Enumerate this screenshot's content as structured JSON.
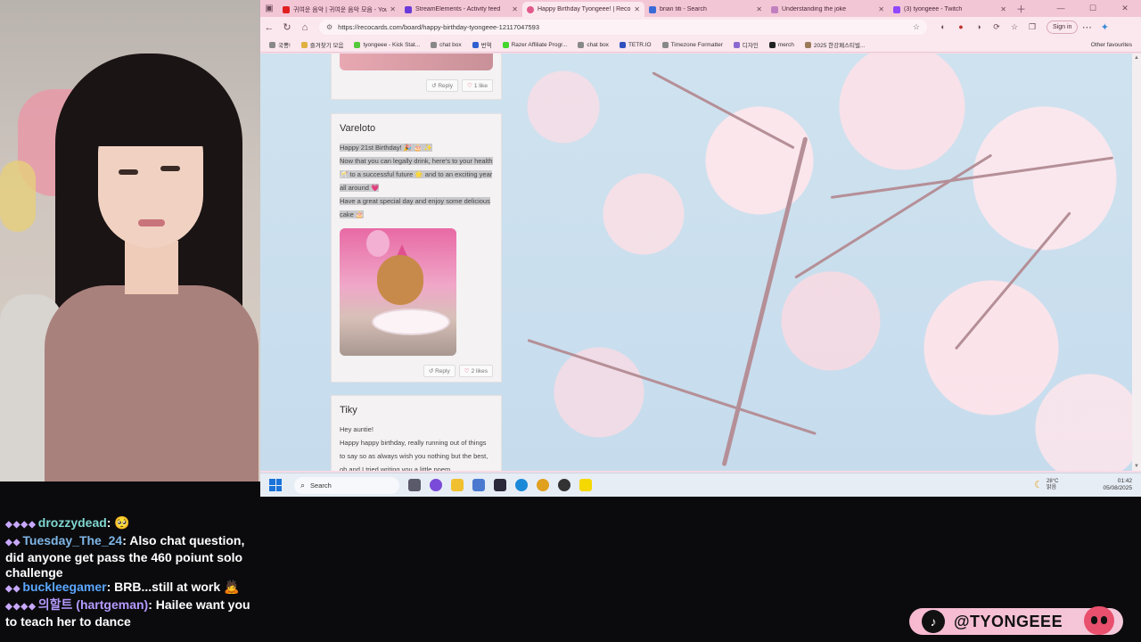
{
  "browser": {
    "tabs": [
      {
        "title": "귀여운 음악 | 귀여운 음악 모음 - YouTube",
        "color": "#e02020",
        "active": false
      },
      {
        "title": "StreamElements - Activity feed",
        "color": "#6a3ad8",
        "active": false
      },
      {
        "title": "Happy Birthday Tyongeee! | Reco",
        "color": "#e05a8a",
        "active": true
      },
      {
        "title": "brian titi - Search",
        "color": "#3a6ad8",
        "active": false
      },
      {
        "title": "Understanding the joke",
        "color": "#c080c0",
        "active": false
      },
      {
        "title": "(3) tyongeee - Twitch",
        "color": "#9146ff",
        "active": false
      }
    ],
    "url": "https://recocards.com/board/happy-birthday-tyongeee-12117047593",
    "signin_label": "Sign in",
    "bookmarks": [
      "국뽕!",
      "즐겨찾기 모음",
      "tyongeee - Kick Stat...",
      "chat box",
      "번역",
      "Razer Affiliate Progr...",
      "chat box",
      "TETR.IO",
      "Timezone Formatter",
      "디자인",
      "merch",
      "2025 한강페스티벌..."
    ],
    "other_favourites": "Other favourites"
  },
  "cards": {
    "top": {
      "reply": "Reply",
      "likes": "1 like"
    },
    "vareloto": {
      "name": "Vareloto",
      "line1": "Happy 21st Birthday! 🎉 🎂 ✨",
      "line2": "Now that you can legally drink, here's to your health 🥂 to a successful future 🌟 and to an exciting year all around 💗",
      "line3": "Have a great special day and enjoy some delicious cake 🎂",
      "reply": "Reply",
      "likes": "2 likes"
    },
    "tiky": {
      "name": "Tiky",
      "line1": "Hey auntie!",
      "line2": "Happy happy birthday, really running out of things to say so as always wish you nothing but the best, oh and I tried writing you a little poem"
    }
  },
  "taskbar": {
    "search": "Search",
    "temp": "28°C",
    "weather": "맑음",
    "time": "01:42",
    "date": "05/08/2025"
  },
  "chat": [
    {
      "user": "drozzydead",
      "text": "",
      "user_color": "#7fd6d0"
    },
    {
      "user": "Tuesday_The_24",
      "text": "Also chat question, did anyone get pass the 460 poiunt solo challenge",
      "user_color": "#7fb6e6"
    },
    {
      "user": "buckleegamer",
      "text": "BRB...still at work 🙇",
      "user_color": "#5aa7ff"
    },
    {
      "user": "의할트 (hartgeman)",
      "text": "Hailee want you to teach her to dance",
      "user_color": "#b49bff"
    }
  ],
  "tiktok": {
    "handle": "@TYONGEEE"
  }
}
